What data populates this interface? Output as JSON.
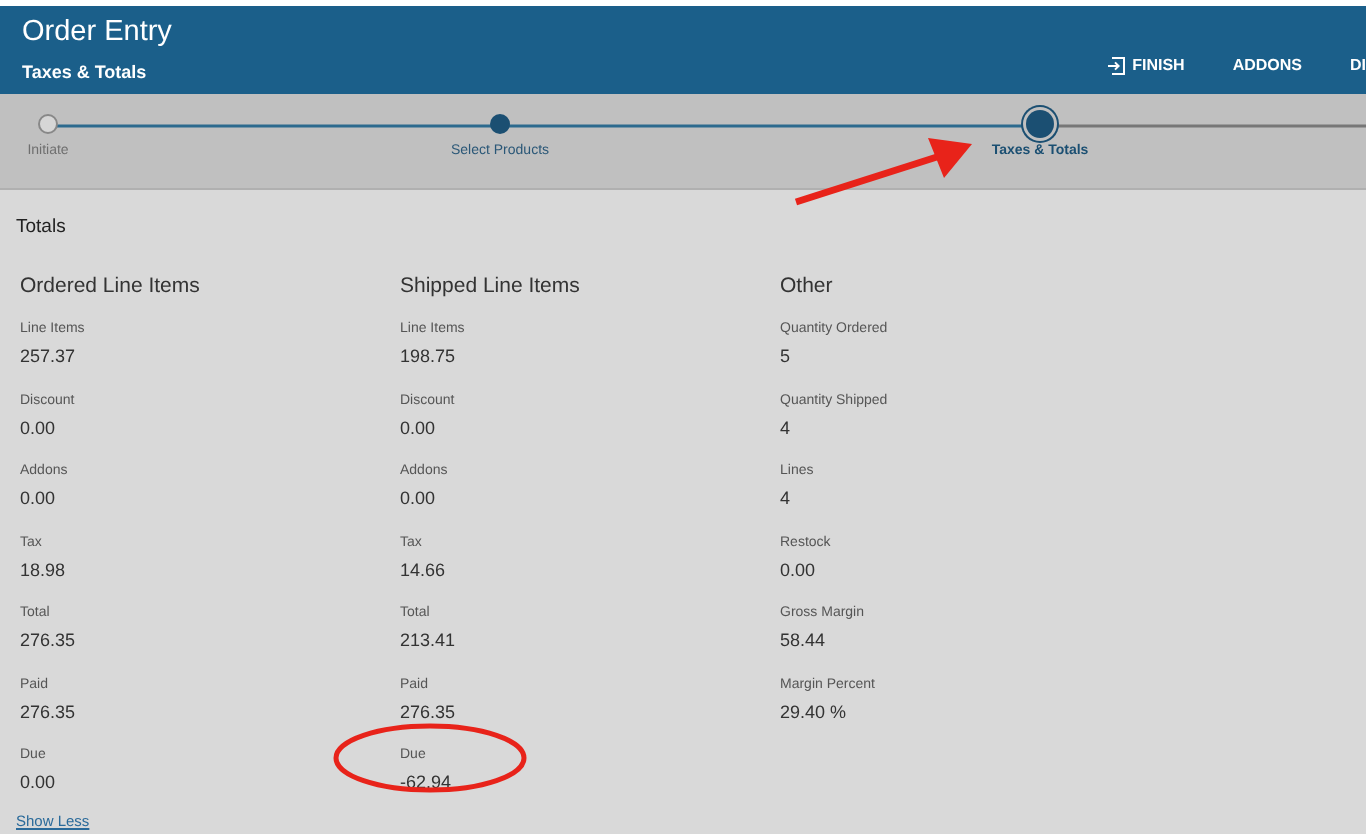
{
  "header": {
    "title": "Order Entry",
    "subtitle": "Taxes & Totals",
    "actions": [
      {
        "label": "FINISH",
        "kind": "icon"
      },
      {
        "label": "ADDONS",
        "kind": "text"
      },
      {
        "label": "DI",
        "kind": "text"
      }
    ]
  },
  "steps": [
    {
      "label": "Initiate",
      "selected": false,
      "disabled": true
    },
    {
      "label": "Select Products",
      "selected": false,
      "disabled": false
    },
    {
      "label": "Taxes & Totals",
      "selected": true,
      "disabled": false
    }
  ],
  "section_title": "Totals",
  "groups": [
    {
      "title": "Ordered Line Items",
      "fields": [
        {
          "label": "Line Items",
          "value": "257.37"
        },
        {
          "label": "Discount",
          "value": "0.00"
        },
        {
          "label": "Addons",
          "value": "0.00"
        },
        {
          "label": "Tax",
          "value": "18.98"
        },
        {
          "label": "Total",
          "value": "276.35"
        },
        {
          "label": "Paid",
          "value": "276.35"
        },
        {
          "label": "Due",
          "value": "0.00"
        }
      ]
    },
    {
      "title": "Shipped Line Items",
      "fields": [
        {
          "label": "Line Items",
          "value": "198.75"
        },
        {
          "label": "Discount",
          "value": "0.00"
        },
        {
          "label": "Addons",
          "value": "0.00"
        },
        {
          "label": "Tax",
          "value": "14.66"
        },
        {
          "label": "Total",
          "value": "213.41"
        },
        {
          "label": "Paid",
          "value": "276.35"
        },
        {
          "label": "Due",
          "value": "-62.94"
        }
      ]
    },
    {
      "title": "Other",
      "fields": [
        {
          "label": "Quantity Ordered",
          "value": "5"
        },
        {
          "label": "Quantity Shipped",
          "value": "4"
        },
        {
          "label": "Lines",
          "value": "4"
        },
        {
          "label": "Restock",
          "value": "0.00"
        },
        {
          "label": "Gross Margin",
          "value": "58.44"
        },
        {
          "label": "Margin Percent",
          "value": "29.40 %"
        }
      ]
    }
  ],
  "show_less": "Show Less"
}
